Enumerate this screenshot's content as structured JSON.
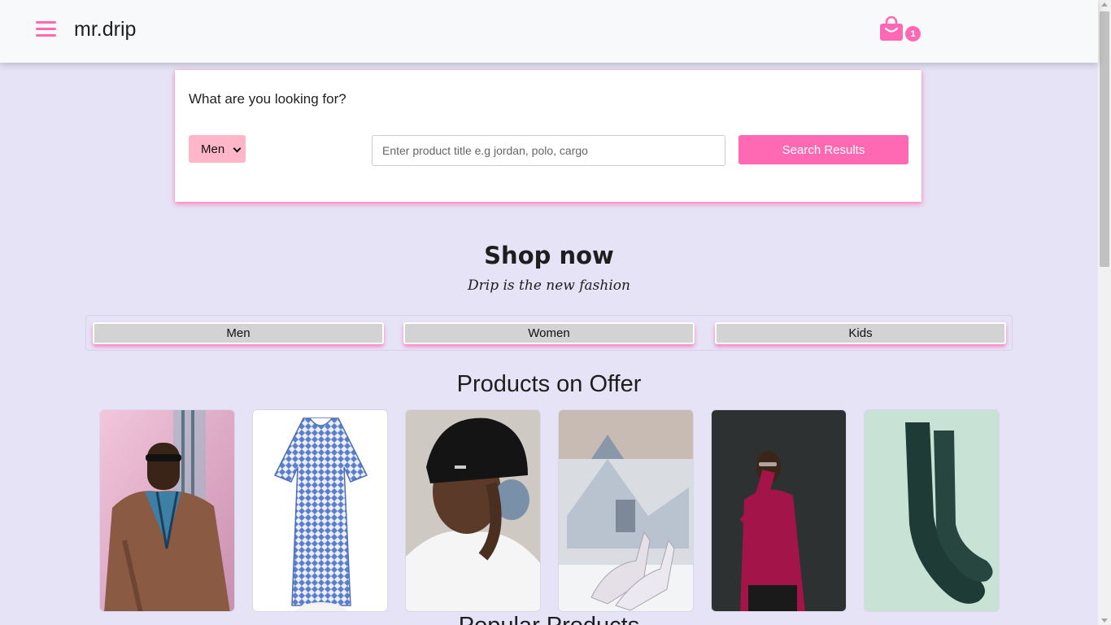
{
  "header": {
    "brand": "mr.drip",
    "cart_count": "1"
  },
  "search": {
    "question": "What are you looking for?",
    "category_selected": "Men",
    "placeholder": "Enter product title e.g jordan, polo, cargo",
    "button_label": "Search Results"
  },
  "shop": {
    "title": "Shop now",
    "subtitle": "Drip is the new fashion",
    "categories": [
      "Men",
      "Women",
      "Kids"
    ]
  },
  "products_title": "Products on Offer",
  "products": [
    {
      "name": "man-leather-jacket-photo"
    },
    {
      "name": "blue-print-dress-photo"
    },
    {
      "name": "woman-black-beanie-photo"
    },
    {
      "name": "silver-heels-photo"
    },
    {
      "name": "man-magenta-sweater-photo"
    },
    {
      "name": "green-socks-photo"
    }
  ],
  "popular_title": "Popular Products",
  "colors": {
    "accent": "#ff69b4",
    "background": "#e6e3f6",
    "select_bg": "#ffb6c8"
  }
}
